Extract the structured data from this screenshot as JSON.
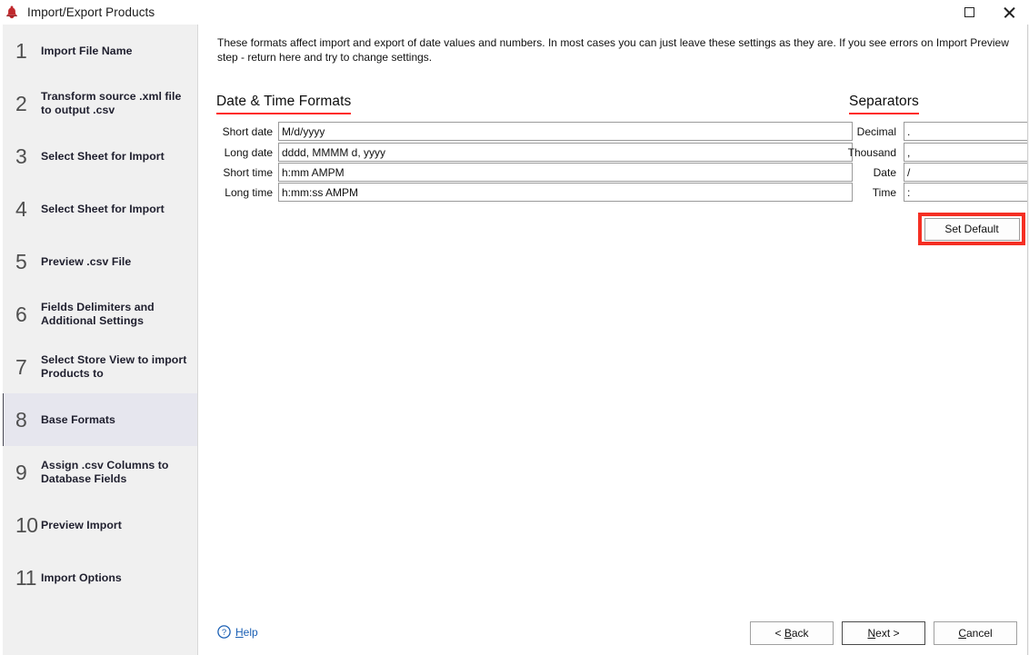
{
  "window": {
    "title": "Import/Export Products",
    "app_icon": "bell-app-icon",
    "controls": {
      "maximize": "maximize-icon",
      "close": "close-icon"
    }
  },
  "sidebar": {
    "items": [
      {
        "num": "1",
        "label": "Import File Name",
        "selected": false
      },
      {
        "num": "2",
        "label": "Transform source .xml file to output .csv",
        "selected": false
      },
      {
        "num": "3",
        "label": "Select Sheet for Import",
        "selected": false
      },
      {
        "num": "4",
        "label": "Select Sheet for Import",
        "selected": false
      },
      {
        "num": "5",
        "label": "Preview .csv File",
        "selected": false
      },
      {
        "num": "6",
        "label": "Fields Delimiters and Additional Settings",
        "selected": false
      },
      {
        "num": "7",
        "label": "Select Store View to import Products to",
        "selected": false
      },
      {
        "num": "8",
        "label": "Base Formats",
        "selected": true
      },
      {
        "num": "9",
        "label": "Assign .csv Columns to Database Fields",
        "selected": false
      },
      {
        "num": "10",
        "label": "Preview Import",
        "selected": false
      },
      {
        "num": "11",
        "label": "Import Options",
        "selected": false
      }
    ]
  },
  "main": {
    "intro": "These formats affect import and export of date values and numbers. In most cases you can just leave these settings as they are. If you see errors on Import Preview step - return here and try to change settings.",
    "datetime": {
      "heading": "Date & Time Formats",
      "rows": [
        {
          "label": "Short date",
          "value": "M/d/yyyy"
        },
        {
          "label": "Long date",
          "value": "dddd, MMMM d, yyyy"
        },
        {
          "label": "Short time",
          "value": "h:mm AMPM"
        },
        {
          "label": "Long time",
          "value": "h:mm:ss AMPM"
        }
      ]
    },
    "separators": {
      "heading": "Separators",
      "rows": [
        {
          "label": "Decimal",
          "value": "."
        },
        {
          "label": "Thousand",
          "value": ","
        },
        {
          "label": "Date",
          "value": "/"
        },
        {
          "label": "Time",
          "value": ":"
        }
      ]
    },
    "set_default_label": "Set Default"
  },
  "footer": {
    "help_label": "Help",
    "help_mnemonic": "H",
    "help_rest": "elp",
    "buttons": [
      {
        "pre": "< ",
        "mnemonic": "B",
        "post": "ack",
        "default": false,
        "name": "back-button"
      },
      {
        "pre": "",
        "mnemonic": "N",
        "post": "ext >",
        "default": true,
        "name": "next-button"
      },
      {
        "pre": "",
        "mnemonic": "C",
        "post": "ancel",
        "default": false,
        "name": "cancel-button"
      }
    ]
  },
  "colors": {
    "annotation_red": "#f52f23",
    "sidebar_bg": "#f0f0f0",
    "selected_step_bg": "#e6e6ee",
    "link_blue": "#1a5fb4"
  }
}
